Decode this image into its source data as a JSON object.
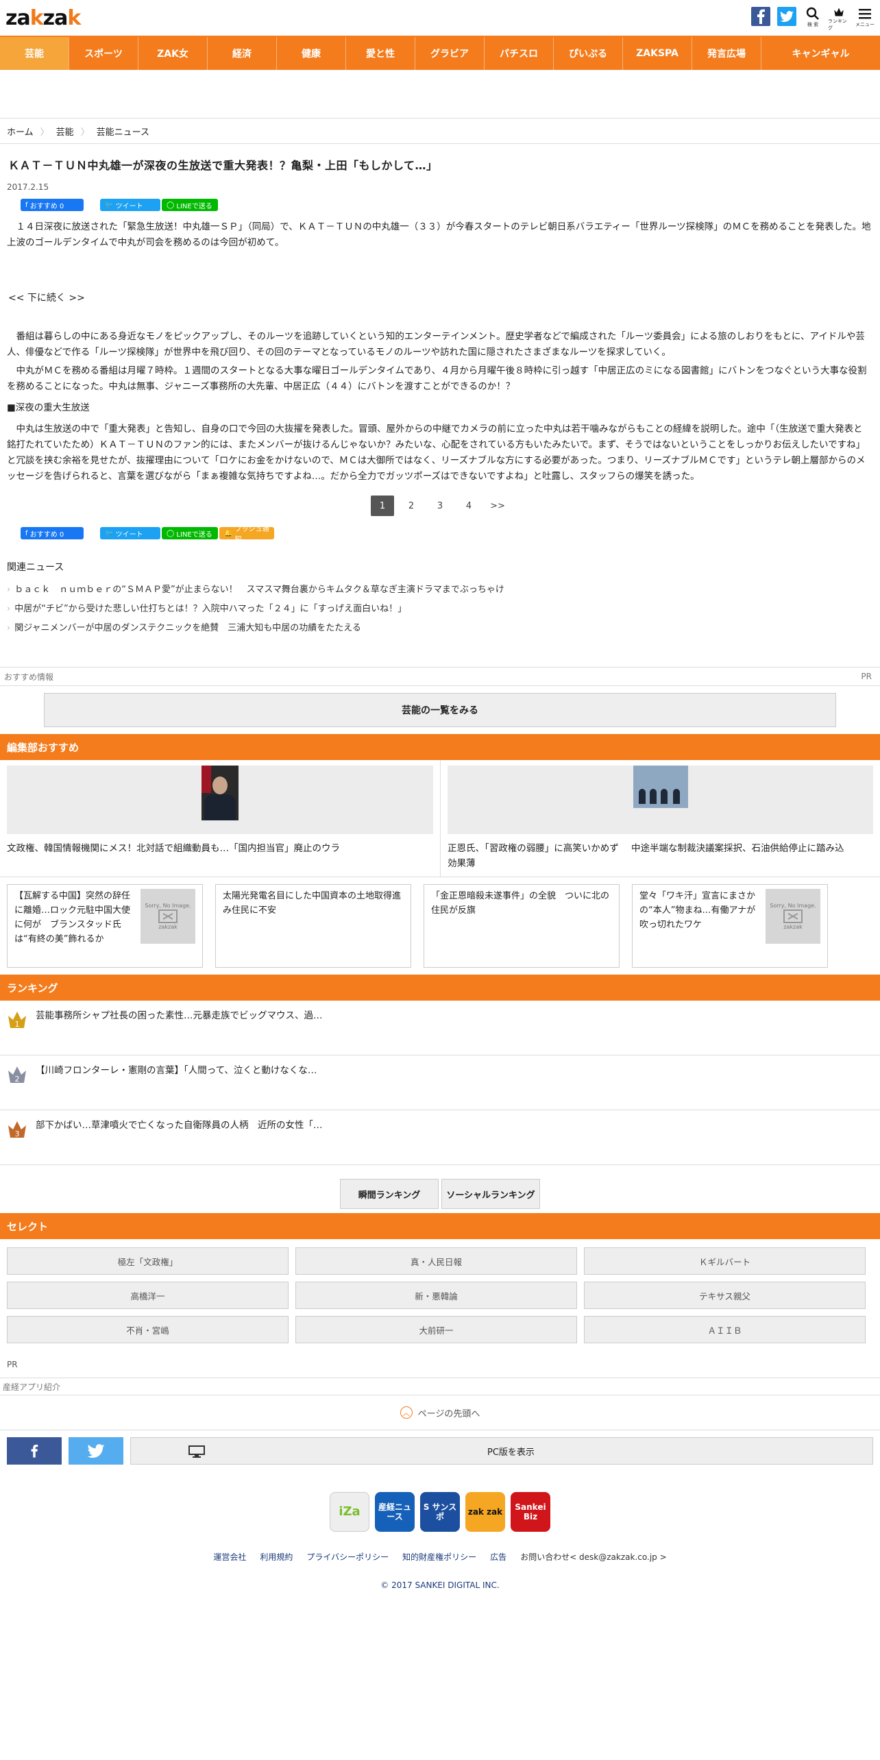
{
  "header": {
    "logo_a": "za",
    "logo_b": "k",
    "logo_c": "za",
    "logo_d": "k",
    "search_label": "検 索",
    "ranking_label": "ランキング",
    "menu_label": "メニュー"
  },
  "nav": [
    "芸能",
    "スポーツ",
    "ZAK女",
    "経済",
    "健康",
    "愛と性",
    "グラビア",
    "パチスロ",
    "ぴいぷる",
    "ZAKSPA",
    "発言広場",
    "キャンギャル"
  ],
  "breadcrumb": [
    "ホーム",
    "芸能",
    "芸能ニュース"
  ],
  "article": {
    "title": "ＫＡＴ－ＴＵＮ中丸雄一が深夜の生放送で重大発表！？亀梨・上田「もしかして…」",
    "date": "2017.2.15",
    "p1": "１４日深夜に放送された「緊急生放送！中丸雄一ＳＰ」（同局）で、ＫＡＴ－ＴＵＮの中丸雄一（３３）が今春スタートのテレビ朝日系バラエティー「世界ルーツ探検隊」のＭＣを務めることを発表した。地上波のゴールデンタイムで中丸が司会を務めるのは今回が初めて。",
    "continue": "<< 下に続く >>",
    "p2": "番組は暮らしの中にある身近なモノをピックアップし、そのルーツを追跡していくという知的エンターテインメント。歴史学者などで編成された「ルーツ委員会」による旅のしおりをもとに、アイドルや芸人、俳優などで作る「ルーツ探検隊」が世界中を飛び回り、その回のテーマとなっているモノのルーツや訪れた国に隠されたさまざまなルーツを探求していく。",
    "p3": "中丸がＭＣを務める番組は月曜７時枠。１週間のスタートとなる大事な曜日ゴールデンタイムであり、４月から月曜午後８時枠に引っ越す「中居正広のミになる図書館」にバトンをつなぐという大事な役割を務めることになった。中丸は無事、ジャニーズ事務所の大先輩、中居正広（４４）にバトンを渡すことができるのか！？",
    "subhead": "■深夜の重大生放送",
    "p4": "中丸は生放送の中で「重大発表」と告知し、自身の口で今回の大抜擢を発表した。冒頭、屋外からの中継でカメラの前に立った中丸は若干噛みながらもことの経緯を説明した。途中「（生放送で重大発表と銘打たれていたため）ＫＡＴ－ＴＵＮのファン的には、またメンバーが抜けるんじゃないか？みたいな、心配をされている方もいたみたいで。まず、そうではないということをしっかりお伝えしたいですね」と冗談を挟む余裕を見せたが、抜擢理由について「ロケにお金をかけないので、ＭＣは大御所ではなく、リーズナブルな方にする必要があった。つまり、リーズナブルＭＣです」というテレ朝上層部からのメッセージを告げられると、言葉を選びながら「まぁ複雑な気持ちですよね…。だから全力でガッツポーズはできないですよね」と吐露し、スタッフらの爆笑を誘った。"
  },
  "share": {
    "fb": "おすすめ 0",
    "tw": "ツイート",
    "line": "LINEで送る",
    "push": "プッシュ通知"
  },
  "pager": {
    "pages": [
      "1",
      "2",
      "3",
      "4"
    ],
    "next": ">>"
  },
  "related": {
    "heading": "関連ニュース",
    "items": [
      "ｂａｃｋ　ｎｕｍｂｅｒの“ＳＭＡＰ愛”が止まらない！　スマスマ舞台裏からキムタク＆草なぎ主演ドラマまでぶっちゃけ",
      "中居が“チビ”から受けた悲しい仕打ちとは！？入院中ハマった「２４」に「すっげえ面白いね！」",
      "関ジャニメンバーが中居のダンステクニックを絶賛　三浦大知も中居の功績をたたえる"
    ]
  },
  "osusume": {
    "label": "おすすめ情報",
    "pr": "PR"
  },
  "more_button": "芸能の一覧をみる",
  "editors": {
    "heading": "編集部おすすめ",
    "left": "文政権、韓国情報機関にメス！北対話で組織動員も…「国内担当官」廃止のウラ",
    "right_a": "正恩氏、「習政権の弱腰」に高笑いかめず効果薄",
    "right_b": "中途半端な制裁決議案採択、石油供給停止に踏み込",
    "cards": [
      "【瓦解する中国】突然の辞任に離婚…ロック元駐中国大使に何が　ブランスタッド氏は“有終の美”飾れるか",
      "太陽光発電名目にした中国資本の土地取得進み住民に不安",
      "「金正恩暗殺未遂事件」の全貌　ついに北の住民が反旗",
      "堂々「ワキ汗」宣言にまさかの“本人”物まね…有働アナが吹っ切れたワケ"
    ],
    "noimage": "Sorry, No Image.",
    "noimage_logo": "zakzak"
  },
  "ranking": {
    "heading": "ランキング",
    "items": [
      {
        "num": "1",
        "text": "芸能事務所シャプ社長の困った素性…元暴走族でビッグマウス、過…",
        "color": "#d4a017"
      },
      {
        "num": "2",
        "text": "【川崎フロンターレ・憲剛の言葉】「人間って、泣くと動けなくな…",
        "color": "#8a8fa0"
      },
      {
        "num": "3",
        "text": "部下かばい…草津噴火で亡くなった自衛隊員の人柄　近所の女性「…",
        "color": "#c0692a"
      }
    ],
    "btn1": "瞬間ランキング",
    "btn2": "ソーシャルランキング"
  },
  "select": {
    "heading": "セレクト",
    "items": [
      "極左「文政権」",
      "真・人民日報",
      "Ｋギルバート",
      "高橋洋一",
      "新・悪韓論",
      "テキサス親父",
      "不肖・宮嶋",
      "大前研一",
      "ＡＩＩＢ"
    ]
  },
  "pr_label": "PR",
  "sankei_app": "産経アプリ紹介",
  "totop": "ページの先頭へ",
  "pc_view": "PC版を表示",
  "apps": [
    {
      "name": "iZa",
      "bg": "#eeeeee",
      "fg": "#7bbd2c"
    },
    {
      "name": "産経ニュース",
      "bg": "#1560b8",
      "fg": "#ffffff"
    },
    {
      "name": "S サンスポ",
      "bg": "#1c4fa0",
      "fg": "#ffffff"
    },
    {
      "name": "zak zak",
      "bg": "#f5a623",
      "fg": "#111111"
    },
    {
      "name": "Sankei Biz",
      "bg": "#d0161b",
      "fg": "#ffffff"
    }
  ],
  "footer_links": [
    "運営会社",
    "利用規約",
    "プライバシーポリシー",
    "知的財産権ポリシー",
    "広告"
  ],
  "contact": "お問い合わせ< desk@zakzak.co.jp >",
  "copyright": "© 2017 SANKEI DIGITAL INC.",
  "colors": {
    "accent": "#f47c1c",
    "facebook": "#3b5998",
    "twitter": "#1da1f2",
    "line": "#00b900"
  }
}
